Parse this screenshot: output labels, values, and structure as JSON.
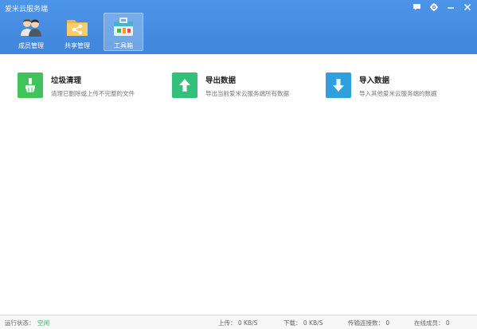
{
  "window": {
    "title": "爱米云服务端",
    "controls": [
      "chat-icon",
      "gear-icon",
      "minimize-icon",
      "close-icon"
    ]
  },
  "nav": {
    "tabs": [
      {
        "label": "成员管理",
        "icon": "members-icon",
        "active": false
      },
      {
        "label": "共享管理",
        "icon": "shared-folder-icon",
        "active": false
      },
      {
        "label": "工具箱",
        "icon": "toolbox-icon",
        "active": true
      }
    ]
  },
  "tools": [
    {
      "title": "垃圾清理",
      "desc": "清理已删除或上传不完整的文件",
      "icon": "broom-icon",
      "color": "#3fc35a"
    },
    {
      "title": "导出数据",
      "desc": "导出当前爱米云服务端所有数据",
      "icon": "arrow-up-icon",
      "color": "#33c07a"
    },
    {
      "title": "导入数据",
      "desc": "导入其他爱米云服务端的数据",
      "icon": "arrow-down-icon",
      "color": "#2f9fde"
    }
  ],
  "status": {
    "run_label": "运行状态：",
    "run_value": "空闲",
    "upload": "上传： 0 KB/S",
    "download": "下载： 0 KB/S",
    "connections": "传输连接数： 0",
    "online": "在线成员： 0"
  }
}
